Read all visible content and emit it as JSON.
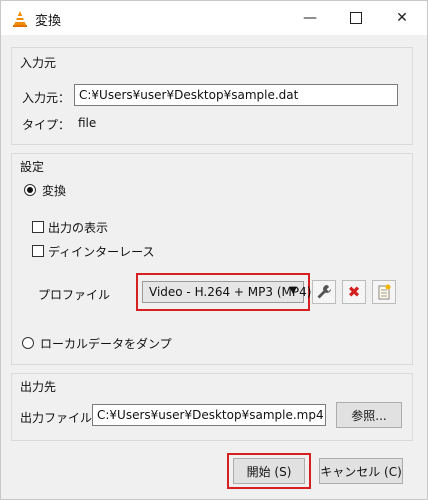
{
  "window": {
    "title": "変換",
    "controls": [
      "minimize-icon",
      "maximize-icon",
      "close-icon"
    ]
  },
  "source": {
    "section_label": "入力元",
    "input_label": "入力元：",
    "input_value": "C:¥Users¥user¥Desktop¥sample.dat",
    "type_label": "タイプ：",
    "type_value": "file"
  },
  "settings": {
    "section_label": "設定",
    "convert_radio_label": "変換",
    "convert_selected": true,
    "show_output_label": "出力の表示",
    "show_output_checked": false,
    "deinterlace_label": "ディインターレース",
    "deinterlace_checked": false,
    "profile_label": "プロファイル",
    "profile_value": "Video - H.264 + MP3 (MP4)",
    "dump_raw_label": "ローカルデータをダンプ",
    "dump_raw_selected": false,
    "profile_icons": [
      "wrench-icon",
      "delete-icon",
      "new-profile-icon"
    ],
    "highlight_color": "#d42020"
  },
  "destination": {
    "section_label": "出力先",
    "file_label": "出力ファイル：",
    "file_value": "C:¥Users¥user¥Desktop¥sample.mp4",
    "browse_label": "参照..."
  },
  "footer": {
    "start_label": "開始 (S)",
    "cancel_label": "キャンセル (C)"
  }
}
